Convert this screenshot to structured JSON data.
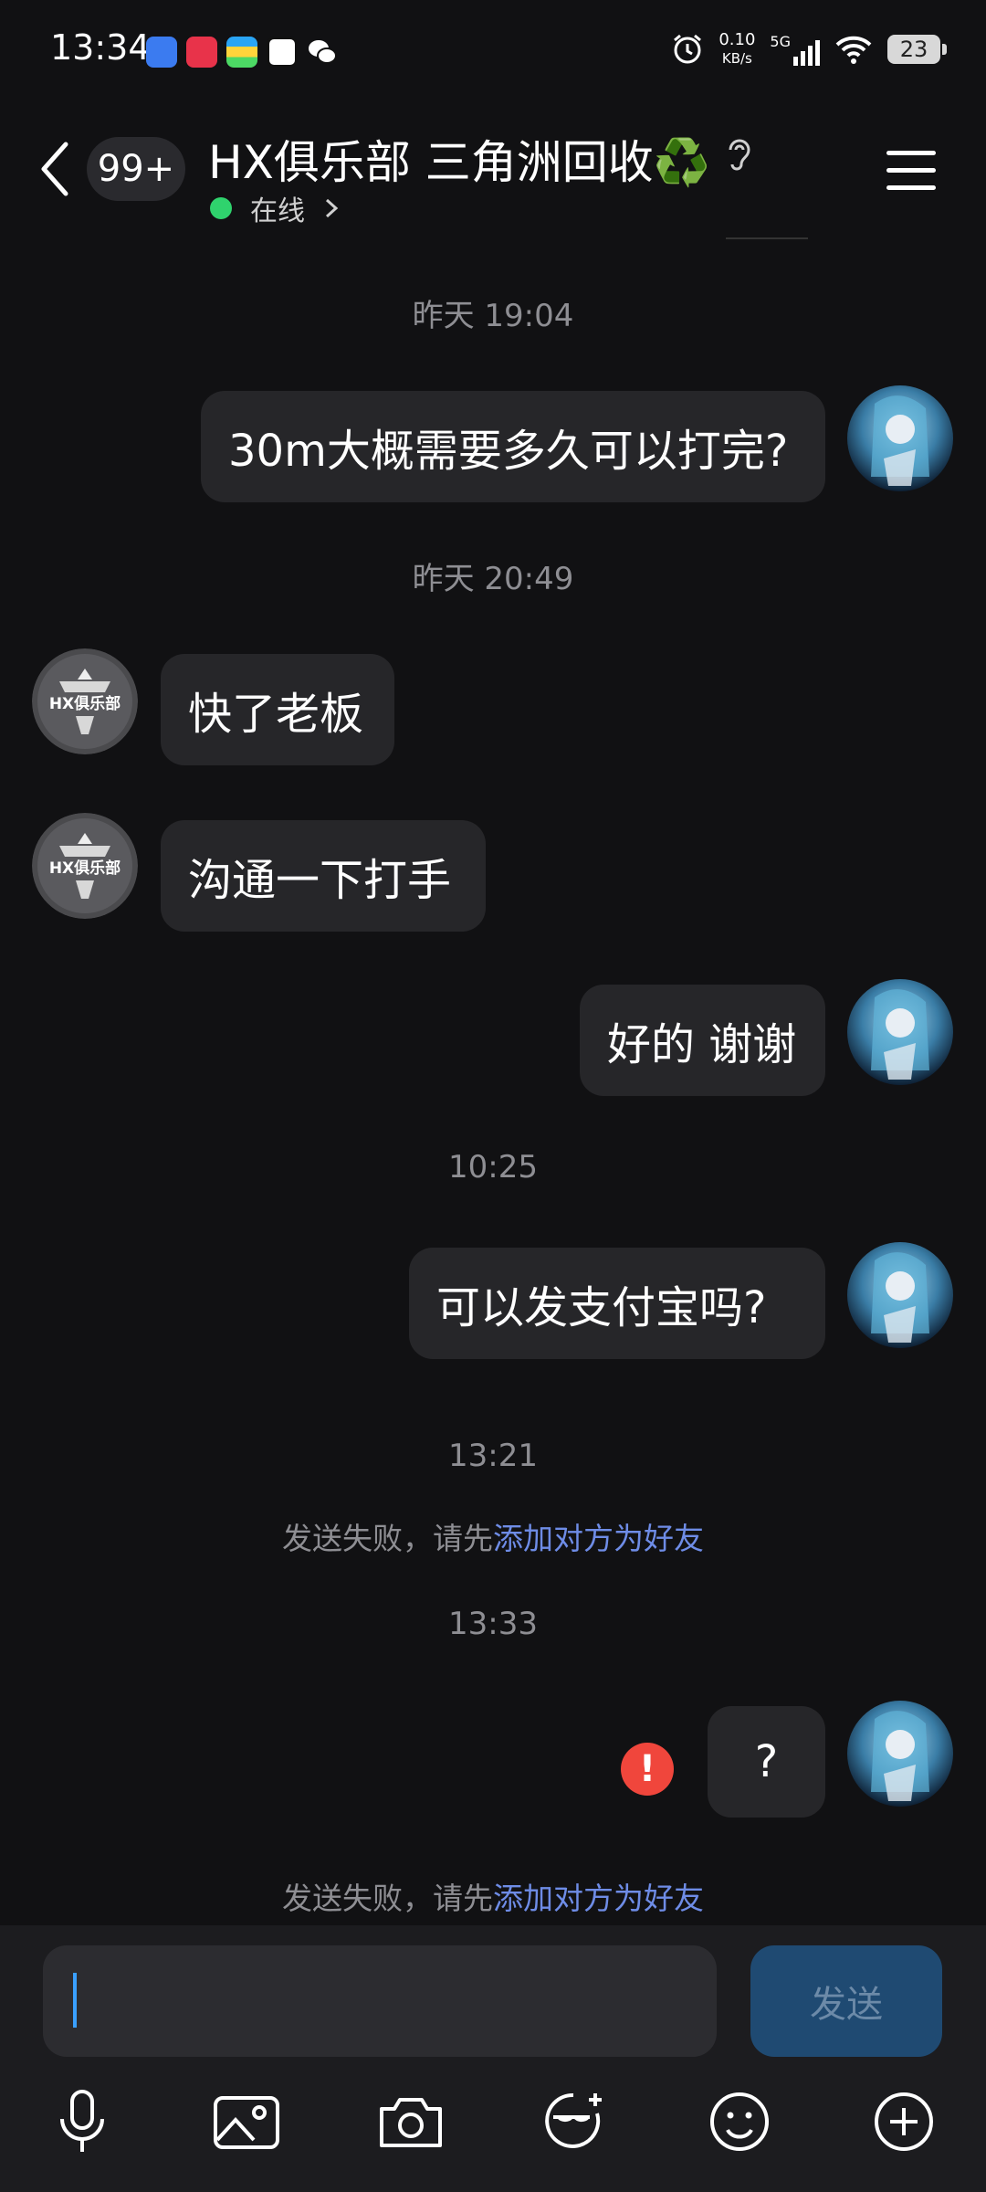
{
  "status_bar": {
    "time": "13:34",
    "net_speed": "0.10",
    "net_unit": "KB/s",
    "network": "5G",
    "battery": "23",
    "app_icons": [
      "app-blue-icon",
      "xiaohongshu-icon",
      "app-stack-icon",
      "meituan-icon",
      "wechat-icon"
    ]
  },
  "header": {
    "back_icon": "chevron-left-icon",
    "unread_badge": "99+",
    "title": "HX俱乐部 三角洲回收♻️",
    "status_text": "在线",
    "menu_icon": "hamburger-menu-icon"
  },
  "messages": {
    "ts1": "昨天 19:04",
    "m1": "30m大概需要多久可以打完?",
    "ts2": "昨天 20:49",
    "m2": "快了老板",
    "m3": "沟通一下打手",
    "m4": "好的 谢谢",
    "ts3": "10:25",
    "m5": "可以发支付宝吗?",
    "ts4": "13:21",
    "notice1_prefix": "发送失败，请先",
    "notice1_link": "添加对方为好友",
    "ts5": "13:33",
    "m6": "?",
    "notice2_prefix": "发送失败，请先",
    "notice2_link": "添加对方为好友"
  },
  "club_avatar_text": "HX俱乐部",
  "input": {
    "placeholder": "",
    "send_label": "发送"
  },
  "toolbar": [
    "microphone-icon",
    "image-icon",
    "camera-icon",
    "face-effect-icon",
    "emoji-icon",
    "plus-icon"
  ],
  "colors": {
    "background": "#111113",
    "bubble": "#262629",
    "online": "#2fd36d",
    "link": "#6e8ce6",
    "error": "#f0463c",
    "send_button": "#1f4a72"
  }
}
